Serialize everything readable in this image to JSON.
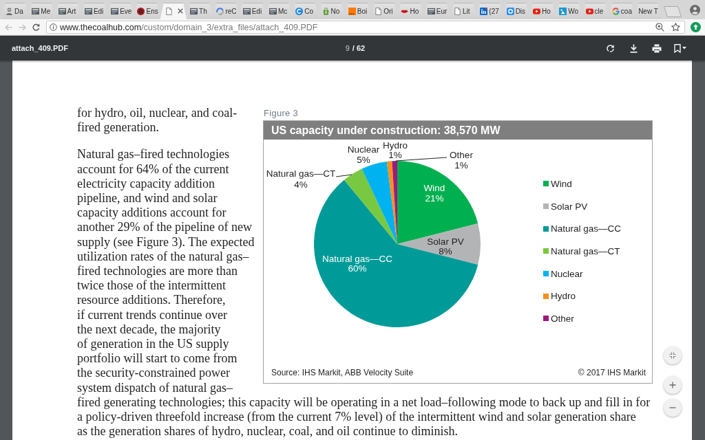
{
  "browser": {
    "tabs": [
      {
        "title": "Da",
        "kind": "person",
        "selected": false
      },
      {
        "title": "Me",
        "kind": "thumbnail",
        "selected": false
      },
      {
        "title": "Art",
        "kind": "thumbnail",
        "selected": false
      },
      {
        "title": "Edi",
        "kind": "thumbnail",
        "selected": false
      },
      {
        "title": "Eve",
        "kind": "thumbnail",
        "selected": false
      },
      {
        "title": "Ens",
        "kind": "roundel",
        "selected": false
      },
      {
        "kind": "page",
        "selected": true
      },
      {
        "title": "Th",
        "kind": "thumbnail",
        "selected": false
      },
      {
        "title": "reC",
        "kind": "arc",
        "selected": false
      },
      {
        "title": "Edi",
        "kind": "thumbnail",
        "selected": false
      },
      {
        "title": "Mc",
        "kind": "thumbnail",
        "selected": false
      },
      {
        "title": "Co",
        "kind": "disc",
        "selected": false
      },
      {
        "title": "No",
        "kind": "bag",
        "selected": false
      },
      {
        "title": "Boi",
        "kind": "square",
        "selected": false
      },
      {
        "title": "Ori",
        "kind": "page",
        "selected": false
      },
      {
        "title": "Ho",
        "kind": "lips",
        "selected": false
      },
      {
        "title": "Eur",
        "kind": "thumbnail",
        "selected": false
      },
      {
        "title": "Lit",
        "kind": "page",
        "selected": false
      },
      {
        "title": "(27",
        "kind": "lettertile",
        "selected": false
      },
      {
        "title": "Dis",
        "kind": "ringtile",
        "selected": false
      },
      {
        "title": "Ho",
        "kind": "play",
        "selected": false
      },
      {
        "title": "Wo",
        "kind": "tile",
        "selected": false
      },
      {
        "title": "cle",
        "kind": "play",
        "selected": false
      },
      {
        "title": "coa",
        "kind": "gring",
        "selected": false
      },
      {
        "title": "New T",
        "selected": false
      }
    ],
    "nav": {
      "back": {
        "disabled": true
      },
      "forward": {
        "disabled": true
      }
    },
    "url": {
      "host": "www.thecoalhub.com",
      "path": "/custom/domain_3/extra_files/attach_409.PDF"
    }
  },
  "pdf_toolbar": {
    "file_name": "attach_409.PDF",
    "page": "9",
    "page_total": "/ 62"
  },
  "document": {
    "column_text": [
      {
        "lines": [
          "for hydro, oil, nuclear, and coal-",
          "fired generation."
        ]
      },
      {
        "lines": [
          "Natural gas–fired technologies",
          "account for 64% of the current",
          "electricity capacity addition",
          "pipeline, and wind and solar",
          "capacity additions account for",
          "another 29% of the pipeline of new",
          "supply (see Figure 3). The expected",
          "utilization rates of the natural gas–",
          "fired technologies are more than",
          "twice those of the intermittent",
          "resource additions. Therefore,",
          "if current trends continue over",
          "the next decade, the majority",
          "of generation in the US supply",
          "portfolio will start to come from",
          "the security-constrained power",
          "system dispatch of natural gas–"
        ]
      }
    ],
    "figure": {
      "label": "Figure 3",
      "chart_data": {
        "type": "pie",
        "title": "US capacity under construction: 38,570 MW",
        "categories": [
          "Wind",
          "Solar PV",
          "Natural gas—CC",
          "Natural gas—CT",
          "Nuclear",
          "Hydro",
          "Other"
        ],
        "values": [
          21,
          8,
          60,
          4,
          5,
          1,
          1
        ],
        "value_labels": [
          "21%",
          "8%",
          "60%",
          "4%",
          "5%",
          "1%",
          "1%"
        ]
      },
      "legend": [
        {
          "label": "Wind",
          "color": "#00b050"
        },
        {
          "label": "Solar PV",
          "color": "#b3b4b6"
        },
        {
          "label": "Natural gas—CC",
          "color": "#009b98"
        },
        {
          "label": "Natural gas—CT",
          "color": "#78c841"
        },
        {
          "label": "Nuclear",
          "color": "#00b2ef"
        },
        {
          "label": "Hydro",
          "color": "#f7901e"
        },
        {
          "label": "Other",
          "color": "#9e1a7e"
        }
      ],
      "source": "Source: IHS Markit, ABB Velocity Suite",
      "copyright": "© 2017 IHS Markit"
    },
    "continuation": {
      "lines": [
        "fired generating technologies; this capacity will be operating in a net load–following mode to back up and fill in for",
        "a policy-driven threefold increase (from the current 7% level) of the intermittent wind and solar generation share",
        "as the generation shares of hydro, nuclear, coal, and oil continue to diminish."
      ]
    }
  }
}
